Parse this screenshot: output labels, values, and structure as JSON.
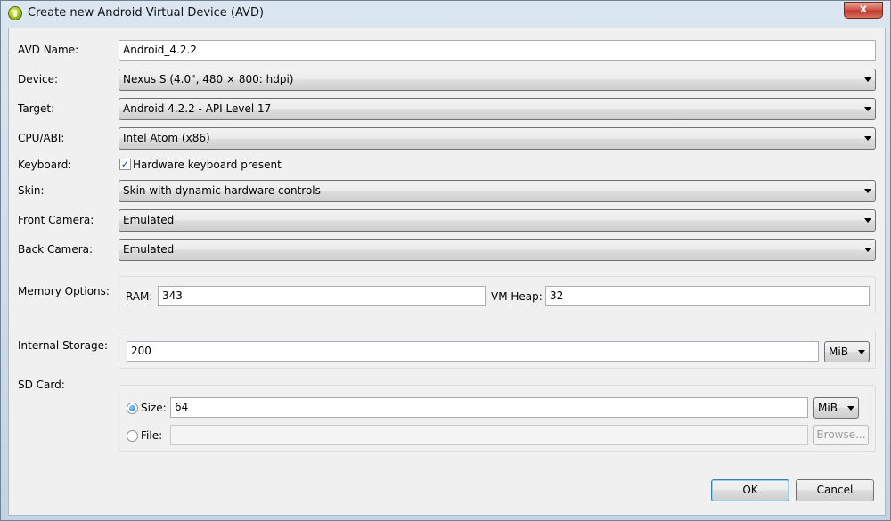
{
  "window": {
    "title": "Create new Android Virtual Device (AVD)",
    "close_glyph": "x"
  },
  "form": {
    "avd_name": {
      "label": "AVD Name:",
      "value": "Android_4.2.2"
    },
    "device": {
      "label": "Device:",
      "value": "Nexus S (4.0\", 480 × 800: hdpi)"
    },
    "target": {
      "label": "Target:",
      "value": "Android 4.2.2 - API Level 17"
    },
    "cpu_abi": {
      "label": "CPU/ABI:",
      "value": "Intel Atom (x86)"
    },
    "keyboard": {
      "label": "Keyboard:",
      "checkbox_label": "Hardware keyboard present",
      "checked": true,
      "check_glyph": "✓"
    },
    "skin": {
      "label": "Skin:",
      "value": "Skin with dynamic hardware controls"
    },
    "front_camera": {
      "label": "Front Camera:",
      "value": "Emulated"
    },
    "back_camera": {
      "label": "Back Camera:",
      "value": "Emulated"
    },
    "memory": {
      "label": "Memory Options:",
      "ram_label": "RAM:",
      "ram_value": "343",
      "vm_heap_label": "VM Heap:",
      "vm_heap_value": "32"
    },
    "internal_storage": {
      "label": "Internal Storage:",
      "value": "200",
      "unit": "MiB"
    },
    "sd_card": {
      "label": "SD Card:",
      "size_label": "Size:",
      "size_value": "64",
      "size_unit": "MiB",
      "size_selected": true,
      "file_label": "File:",
      "file_value": "",
      "browse_label": "Browse..."
    }
  },
  "buttons": {
    "ok": "OK",
    "cancel": "Cancel"
  }
}
